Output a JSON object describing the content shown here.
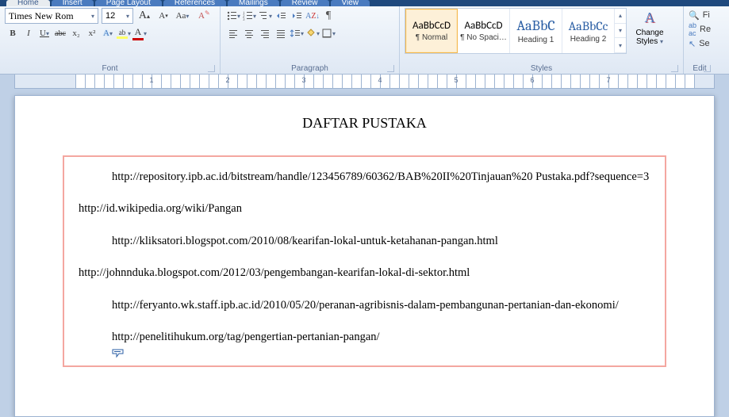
{
  "tabs": [
    "Home",
    "Insert",
    "Page Layout",
    "References",
    "Mailings",
    "Review",
    "View"
  ],
  "active_tab": 0,
  "font": {
    "name": "Times New Rom",
    "size": "12",
    "grow": "A",
    "shrink": "A",
    "case": "Aa",
    "clear": "A",
    "bold": "B",
    "italic": "I",
    "underline": "U",
    "strike": "abc",
    "sub": "x₂",
    "sup": "x²",
    "effects": "A",
    "highlight": "A",
    "color": "A",
    "group_label": "Font"
  },
  "paragraph": {
    "group_label": "Paragraph"
  },
  "styles": {
    "items": [
      {
        "preview": "AaBbCcD",
        "name": "¶ Normal",
        "color": "#000",
        "ff": "Calibri",
        "size": "13px"
      },
      {
        "preview": "AaBbCcD",
        "name": "¶ No Spaci…",
        "color": "#000",
        "ff": "Calibri",
        "size": "13px"
      },
      {
        "preview": "AaBbC",
        "name": "Heading 1",
        "color": "#2a5ea4",
        "ff": "Cambria",
        "size": "18px"
      },
      {
        "preview": "AaBbCc",
        "name": "Heading 2",
        "color": "#2a5ea4",
        "ff": "Cambria",
        "size": "16px"
      }
    ],
    "change_label_1": "Change",
    "change_label_2": "Styles",
    "group_label": "Styles"
  },
  "editing": {
    "find": "Fi",
    "replace": "Re",
    "select": "Se",
    "group_label": "Edit"
  },
  "ruler_numbers": [
    "1",
    "2",
    "3",
    "4",
    "5",
    "6",
    "7"
  ],
  "document": {
    "title": "DAFTAR PUSTAKA",
    "items": [
      {
        "cls": "indent",
        "text": "http://repository.ipb.ac.id/bitstream/handle/123456789/60362/BAB%20II%20Tinjauan%20 Pustaka.pdf?sequence=3"
      },
      {
        "cls": "flush",
        "text": "http://id.wikipedia.org/wiki/Pangan"
      },
      {
        "cls": "indent",
        "text": "http://kliksatori.blogspot.com/2010/08/kearifan-lokal-untuk-ketahanan-pangan.html"
      },
      {
        "cls": "flush",
        "text": "http://johnnduka.blogspot.com/2012/03/pengembangan-kearifan-lokal-di-sektor.html"
      },
      {
        "cls": "indent",
        "text": "http://feryanto.wk.staff.ipb.ac.id/2010/05/20/peranan-agribisnis-dalam-pembangunan-pertanian-dan-ekonomi/"
      },
      {
        "cls": "indent",
        "text": "http://penelitihukum.org/tag/pengertian-pertanian-pangan/"
      }
    ]
  }
}
